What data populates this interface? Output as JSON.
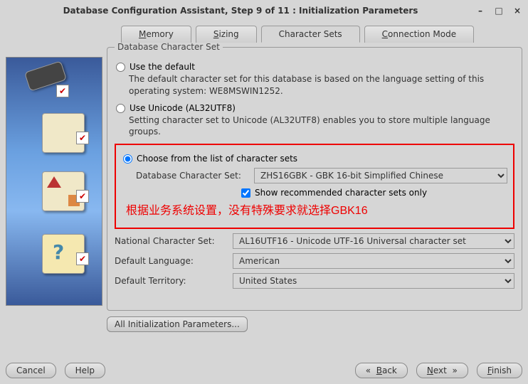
{
  "window": {
    "title": "Database Configuration Assistant, Step 9 of 11 : Initialization Parameters"
  },
  "tabs": {
    "memory": "Memory",
    "sizing": "Sizing",
    "charsets": "Character Sets",
    "connmode": "Connection Mode"
  },
  "groupboxTitle": "Database Character Set",
  "radio1": {
    "label": "Use the default",
    "desc": "The default character set for this database is based on the language setting of this operating system: WE8MSWIN1252."
  },
  "radio2": {
    "label": "Use Unicode (AL32UTF8)",
    "desc": "Setting character set to Unicode (AL32UTF8) enables you to store multiple language groups."
  },
  "radio3": {
    "label": "Choose from the list of character sets"
  },
  "dbCharsetLabel": "Database Character Set:",
  "dbCharsetValue": "ZHS16GBK - GBK 16-bit Simplified Chinese",
  "showRecommended": "Show recommended character sets only",
  "annotation": "根据业务系统设置，没有特殊要求就选择GBK16",
  "nationalLabel": "National Character Set:",
  "nationalValue": "AL16UTF16 - Unicode UTF-16 Universal character set",
  "defaultLangLabel": "Default Language:",
  "defaultLangValue": "American",
  "defaultTerrLabel": "Default Territory:",
  "defaultTerrValue": "United States",
  "allParams": "All Initialization Parameters...",
  "buttons": {
    "cancel": "Cancel",
    "help": "Help",
    "back": "Back",
    "next": "Next",
    "finish": "Finish"
  }
}
